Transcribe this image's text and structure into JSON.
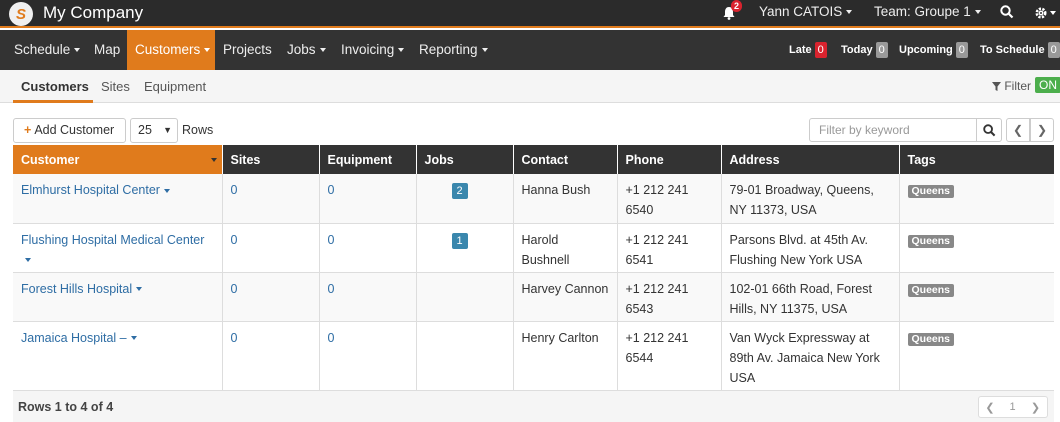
{
  "topbar": {
    "logo_letter": "S",
    "company": "My Company",
    "notif_count": "2",
    "user": "Yann CATOIS",
    "team": "Team: Groupe 1"
  },
  "nav": {
    "items": [
      {
        "label": "Schedule",
        "dropdown": true
      },
      {
        "label": "Map",
        "dropdown": false
      },
      {
        "label": "Customers",
        "dropdown": true,
        "active": true
      },
      {
        "label": "Projects",
        "dropdown": false
      },
      {
        "label": "Jobs",
        "dropdown": true
      },
      {
        "label": "Invoicing",
        "dropdown": true
      },
      {
        "label": "Reporting",
        "dropdown": true
      }
    ],
    "status": [
      {
        "label": "Late",
        "count": "0",
        "color": "#d9232e"
      },
      {
        "label": "Today",
        "count": "0",
        "color": "#999999"
      },
      {
        "label": "Upcoming",
        "count": "0",
        "color": "#999999"
      },
      {
        "label": "To Schedule",
        "count": "0",
        "color": "#999999"
      }
    ]
  },
  "subnav": {
    "tabs": [
      "Customers",
      "Sites",
      "Equipment"
    ],
    "filter_label": "Filter",
    "filter_state": "ON"
  },
  "toolbar": {
    "add_label": "Add Customer",
    "rows_value": "25",
    "rows_label": "Rows",
    "search_placeholder": "Filter by keyword"
  },
  "table": {
    "columns": [
      "Customer",
      "Sites",
      "Equipment",
      "Jobs",
      "Contact",
      "Phone",
      "Address",
      "Tags"
    ],
    "rows": [
      {
        "customer": "Elmhurst Hospital Center",
        "sites": "0",
        "equipment": "0",
        "jobs": "2",
        "contact": "Hanna Bush",
        "phone": "+1 212 241 6540",
        "address": "79-01 Broadway, Queens, NY 11373, USA",
        "tag": "Queens"
      },
      {
        "customer": "Flushing Hospital Medical Center",
        "sites": "0",
        "equipment": "0",
        "jobs": "1",
        "contact": "Harold Bushnell",
        "phone": "+1 212 241 6541",
        "address": "Parsons Blvd. at 45th Av. Flushing New York USA",
        "tag": "Queens"
      },
      {
        "customer": "Forest Hills Hospital",
        "sites": "0",
        "equipment": "0",
        "jobs": "",
        "contact": "Harvey Cannon",
        "phone": "+1 212 241 6543",
        "address": "102-01 66th Road, Forest Hills, NY 11375, USA",
        "tag": "Queens"
      },
      {
        "customer": "Jamaica Hospital –",
        "sites": "0",
        "equipment": "0",
        "jobs": "",
        "contact": "Henry Carlton",
        "phone": "+1 212 241 6544",
        "address": "Van Wyck Expressway at 89th Av. Jamaica New York USA",
        "tag": "Queens"
      }
    ]
  },
  "footer": {
    "summary": "Rows 1 to 4 of 4",
    "page": "1"
  },
  "colors": {
    "accent": "#e07b1c",
    "dark": "#333333",
    "link": "#2e6da4",
    "on": "#4cae4c"
  }
}
